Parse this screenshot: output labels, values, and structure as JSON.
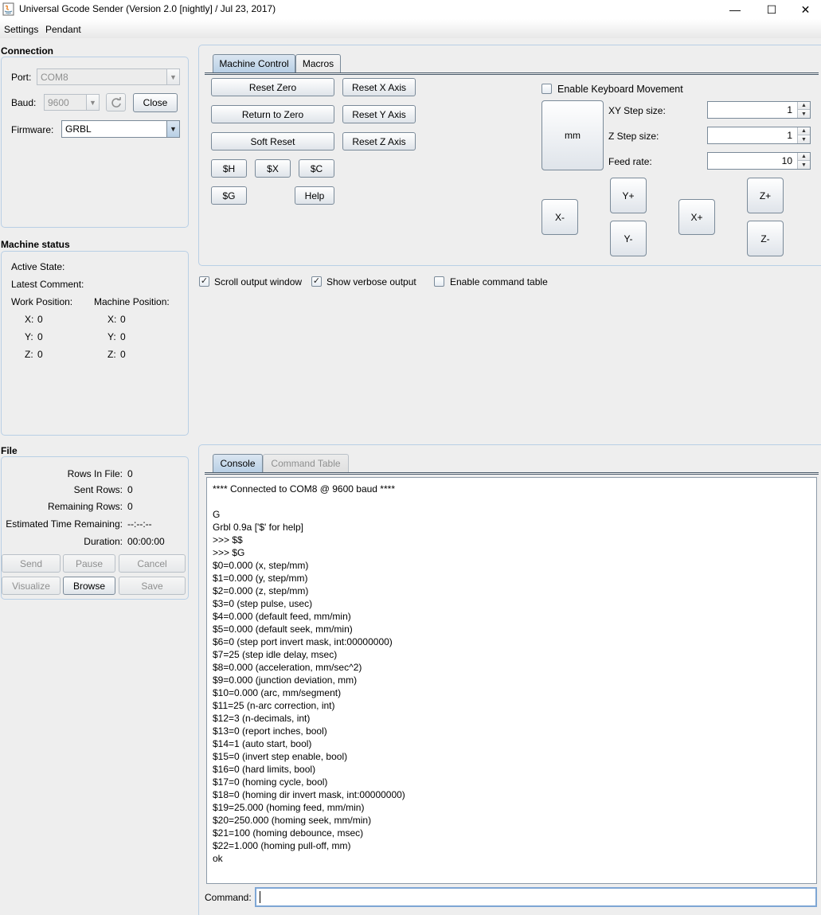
{
  "window": {
    "title": "Universal Gcode Sender (Version 2.0 [nightly]  / Jul 23, 2017)",
    "minimize_glyph": "—",
    "maximize_glyph": "☐",
    "close_glyph": "✕"
  },
  "menu": [
    "Settings",
    "Pendant"
  ],
  "connection": {
    "title": "Connection",
    "port_label": "Port:",
    "port_value": "COM8",
    "baud_label": "Baud:",
    "baud_value": "9600",
    "close_button": "Close",
    "firmware_label": "Firmware:",
    "firmware_value": "GRBL"
  },
  "machine_status": {
    "title": "Machine status",
    "active_state_label": "Active State:",
    "latest_comment_label": "Latest Comment:",
    "work_position_label": "Work Position:",
    "machine_position_label": "Machine Position:",
    "work": [
      {
        "axis": "X:",
        "value": "0"
      },
      {
        "axis": "Y:",
        "value": "0"
      },
      {
        "axis": "Z:",
        "value": "0"
      }
    ],
    "machine": [
      {
        "axis": "X:",
        "value": "0"
      },
      {
        "axis": "Y:",
        "value": "0"
      },
      {
        "axis": "Z:",
        "value": "0"
      }
    ]
  },
  "file": {
    "title": "File",
    "rows_in_file_label": "Rows In File:",
    "rows_in_file": "0",
    "sent_rows_label": "Sent Rows:",
    "sent_rows": "0",
    "remaining_rows_label": "Remaining Rows:",
    "remaining_rows": "0",
    "estimated_time_label": "Estimated Time Remaining:",
    "estimated_time": "--:--:--",
    "duration_label": "Duration:",
    "duration": "00:00:00",
    "buttons": {
      "send": "Send",
      "pause": "Pause",
      "cancel": "Cancel",
      "visualize": "Visualize",
      "browse": "Browse",
      "save": "Save"
    }
  },
  "control_tabs": {
    "machine_control": "Machine Control",
    "macros": "Macros"
  },
  "machine_control": {
    "reset_zero": "Reset Zero",
    "return_to_zero": "Return to Zero",
    "soft_reset": "Soft Reset",
    "reset_x": "Reset X Axis",
    "reset_y": "Reset Y Axis",
    "reset_z": "Reset Z Axis",
    "cmd_h": "$H",
    "cmd_x": "$X",
    "cmd_c": "$C",
    "cmd_g": "$G",
    "help": "Help",
    "enable_keyboard": "Enable Keyboard Movement",
    "unit_button": "mm",
    "xy_step_label": "XY Step size:",
    "xy_step": "1",
    "z_step_label": "Z Step size:",
    "z_step": "1",
    "feed_rate_label": "Feed rate:",
    "feed_rate": "10",
    "jog": {
      "x_minus": "X-",
      "x_plus": "X+",
      "y_plus": "Y+",
      "y_minus": "Y-",
      "z_plus": "Z+",
      "z_minus": "Z-"
    }
  },
  "options": {
    "scroll_output": {
      "label": "Scroll output window",
      "checked": true
    },
    "show_verbose": {
      "label": "Show verbose output",
      "checked": true
    },
    "enable_command_table": {
      "label": "Enable command table",
      "checked": false
    }
  },
  "console_tabs": {
    "console": "Console",
    "command_table": "Command Table"
  },
  "console_lines": [
    "**** Connected to COM8 @ 9600 baud ****",
    "",
    "G",
    "Grbl 0.9a ['$' for help]",
    ">>> $$",
    ">>> $G",
    "$0=0.000 (x, step/mm)",
    "$1=0.000 (y, step/mm)",
    "$2=0.000 (z, step/mm)",
    "$3=0 (step pulse, usec)",
    "$4=0.000 (default feed, mm/min)",
    "$5=0.000 (default seek, mm/min)",
    "$6=0 (step port invert mask, int:00000000)",
    "$7=25 (step idle delay, msec)",
    "$8=0.000 (acceleration, mm/sec^2)",
    "$9=0.000 (junction deviation, mm)",
    "$10=0.000 (arc, mm/segment)",
    "$11=25 (n-arc correction, int)",
    "$12=3 (n-decimals, int)",
    "$13=0 (report inches, bool)",
    "$14=1 (auto start, bool)",
    "$15=0 (invert step enable, bool)",
    "$16=0 (hard limits, bool)",
    "$17=0 (homing cycle, bool)",
    "$18=0 (homing dir invert mask, int:00000000)",
    "$19=25.000 (homing feed, mm/min)",
    "$20=250.000 (homing seek, mm/min)",
    "$21=100 (homing debounce, msec)",
    "$22=1.000 (homing pull-off, mm)",
    "ok"
  ],
  "command": {
    "label": "Command:",
    "value": ""
  }
}
